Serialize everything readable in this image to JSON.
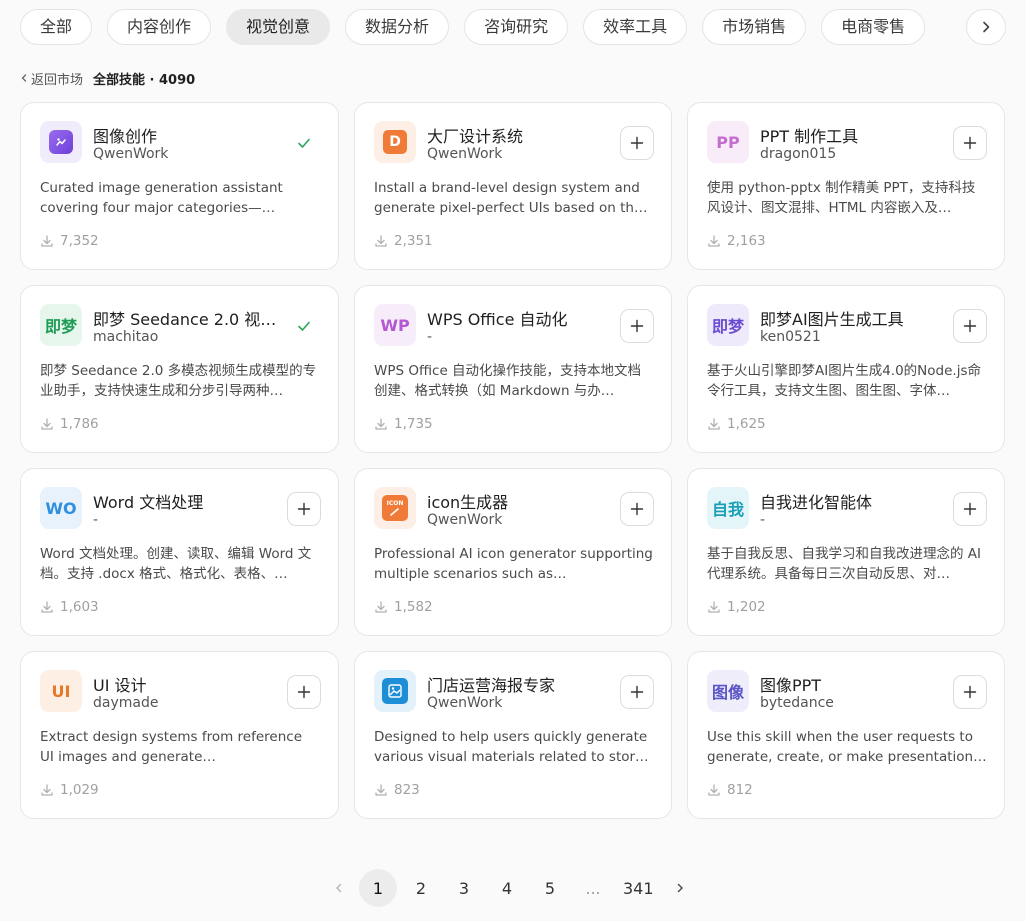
{
  "tabs": [
    {
      "label": "全部",
      "active": false
    },
    {
      "label": "内容创作",
      "active": false
    },
    {
      "label": "视觉创意",
      "active": true
    },
    {
      "label": "数据分析",
      "active": false
    },
    {
      "label": "咨询研究",
      "active": false
    },
    {
      "label": "效率工具",
      "active": false
    },
    {
      "label": "市场销售",
      "active": false
    },
    {
      "label": "电商零售",
      "active": false
    }
  ],
  "breadcrumb": {
    "back_label": "返回市场",
    "title": "全部技能 · 4090"
  },
  "skills": [
    {
      "name": "图像创作",
      "author": "QwenWork",
      "desc": "Curated image generation assistant covering four major categories—…",
      "downloads": "7,352",
      "installed": true,
      "icon": {
        "text": "",
        "kind": "image-gen-icon",
        "fg": "#ffffff",
        "bg": "#f1ecfb"
      }
    },
    {
      "name": "大厂设计系统",
      "author": "QwenWork",
      "desc": "Install a brand-level design system and generate pixel-perfect UIs based on th…",
      "downloads": "2,351",
      "installed": false,
      "icon": {
        "text": "D",
        "kind": "design-system-icon",
        "fg": "#ffffff",
        "bg": "#fdeee6"
      }
    },
    {
      "name": "PPT 制作工具",
      "author": "dragon015",
      "desc": "使用 python-pptx 制作精美 PPT，支持科技风设计、图文混排、HTML 内容嵌入及…",
      "downloads": "2,163",
      "installed": false,
      "icon": {
        "text": "PP",
        "kind": "ppt-icon",
        "fg": "#c46fd0",
        "bg": "#f8ecf9"
      }
    },
    {
      "name": "即梦 Seedance 2.0 视…",
      "author": "machitao",
      "desc": "即梦 Seedance 2.0 多模态视频生成模型的专业助手，支持快速生成和分步引导两种…",
      "downloads": "1,786",
      "installed": true,
      "icon": {
        "text": "即梦",
        "kind": "jimeng-icon",
        "fg": "#1d9c55",
        "bg": "#e6f6ec"
      }
    },
    {
      "name": "WPS Office 自动化",
      "author": "-",
      "desc": "WPS Office 自动化操作技能，支持本地文档创建、格式转换（如 Markdown 与办…",
      "downloads": "1,735",
      "installed": false,
      "icon": {
        "text": "WP",
        "kind": "wps-icon",
        "fg": "#b457d2",
        "bg": "#f6ecfa"
      }
    },
    {
      "name": "即梦AI图片生成工具",
      "author": "ken0521",
      "desc": "基于火山引擎即梦AI图片生成4.0的Node.js命令行工具，支持文生图、图生图、字体…",
      "downloads": "1,625",
      "installed": false,
      "icon": {
        "text": "即梦",
        "kind": "jimeng-image-icon",
        "fg": "#6a4bd1",
        "bg": "#efeafb"
      }
    },
    {
      "name": "Word 文档处理",
      "author": "-",
      "desc": "Word 文档处理。创建、读取、编辑 Word 文档。支持 .docx 格式、格式化、表格、…",
      "downloads": "1,603",
      "installed": false,
      "icon": {
        "text": "WO",
        "kind": "word-icon",
        "fg": "#2f8fe0",
        "bg": "#e7f2fc"
      }
    },
    {
      "name": "icon生成器",
      "author": "QwenWork",
      "desc": "Professional AI icon generator supporting multiple scenarios such as…",
      "downloads": "1,582",
      "installed": false,
      "icon": {
        "text": "ICON",
        "kind": "icon-generator-icon",
        "fg": "#ffffff",
        "bg": "#fdeee6"
      }
    },
    {
      "name": "自我进化智能体",
      "author": "-",
      "desc": "基于自我反思、自我学习和自我改进理念的 AI 代理系统。具备每日三次自动反思、对…",
      "downloads": "1,202",
      "installed": false,
      "icon": {
        "text": "自我",
        "kind": "self-evolve-icon",
        "fg": "#1a9fb6",
        "bg": "#e3f5f8"
      }
    },
    {
      "name": "UI 设计",
      "author": "daymade",
      "desc": "Extract design systems from reference UI images and generate…",
      "downloads": "1,029",
      "installed": false,
      "icon": {
        "text": "UI",
        "kind": "ui-design-icon",
        "fg": "#e8782a",
        "bg": "#fdefe4"
      }
    },
    {
      "name": "门店运营海报专家",
      "author": "QwenWork",
      "desc": "Designed to help users quickly generate various visual materials related to stor…",
      "downloads": "823",
      "installed": false,
      "icon": {
        "text": "",
        "kind": "poster-icon",
        "fg": "#ffffff",
        "bg": "#e3f1fb"
      }
    },
    {
      "name": "图像PPT",
      "author": "bytedance",
      "desc": "Use this skill when the user requests to generate, create, or make presentation…",
      "downloads": "812",
      "installed": false,
      "icon": {
        "text": "图像",
        "kind": "image-ppt-icon",
        "fg": "#5b55c6",
        "bg": "#eeedf9"
      }
    }
  ],
  "pagination": {
    "pages": [
      "1",
      "2",
      "3",
      "4",
      "5",
      "...",
      "341"
    ],
    "current": "1"
  },
  "colors": {
    "accent_check": "#2fa55a",
    "active_tab_bg": "#e9e9e9",
    "card_border": "#e6e6e6",
    "muted_text": "#a0a0a0"
  }
}
